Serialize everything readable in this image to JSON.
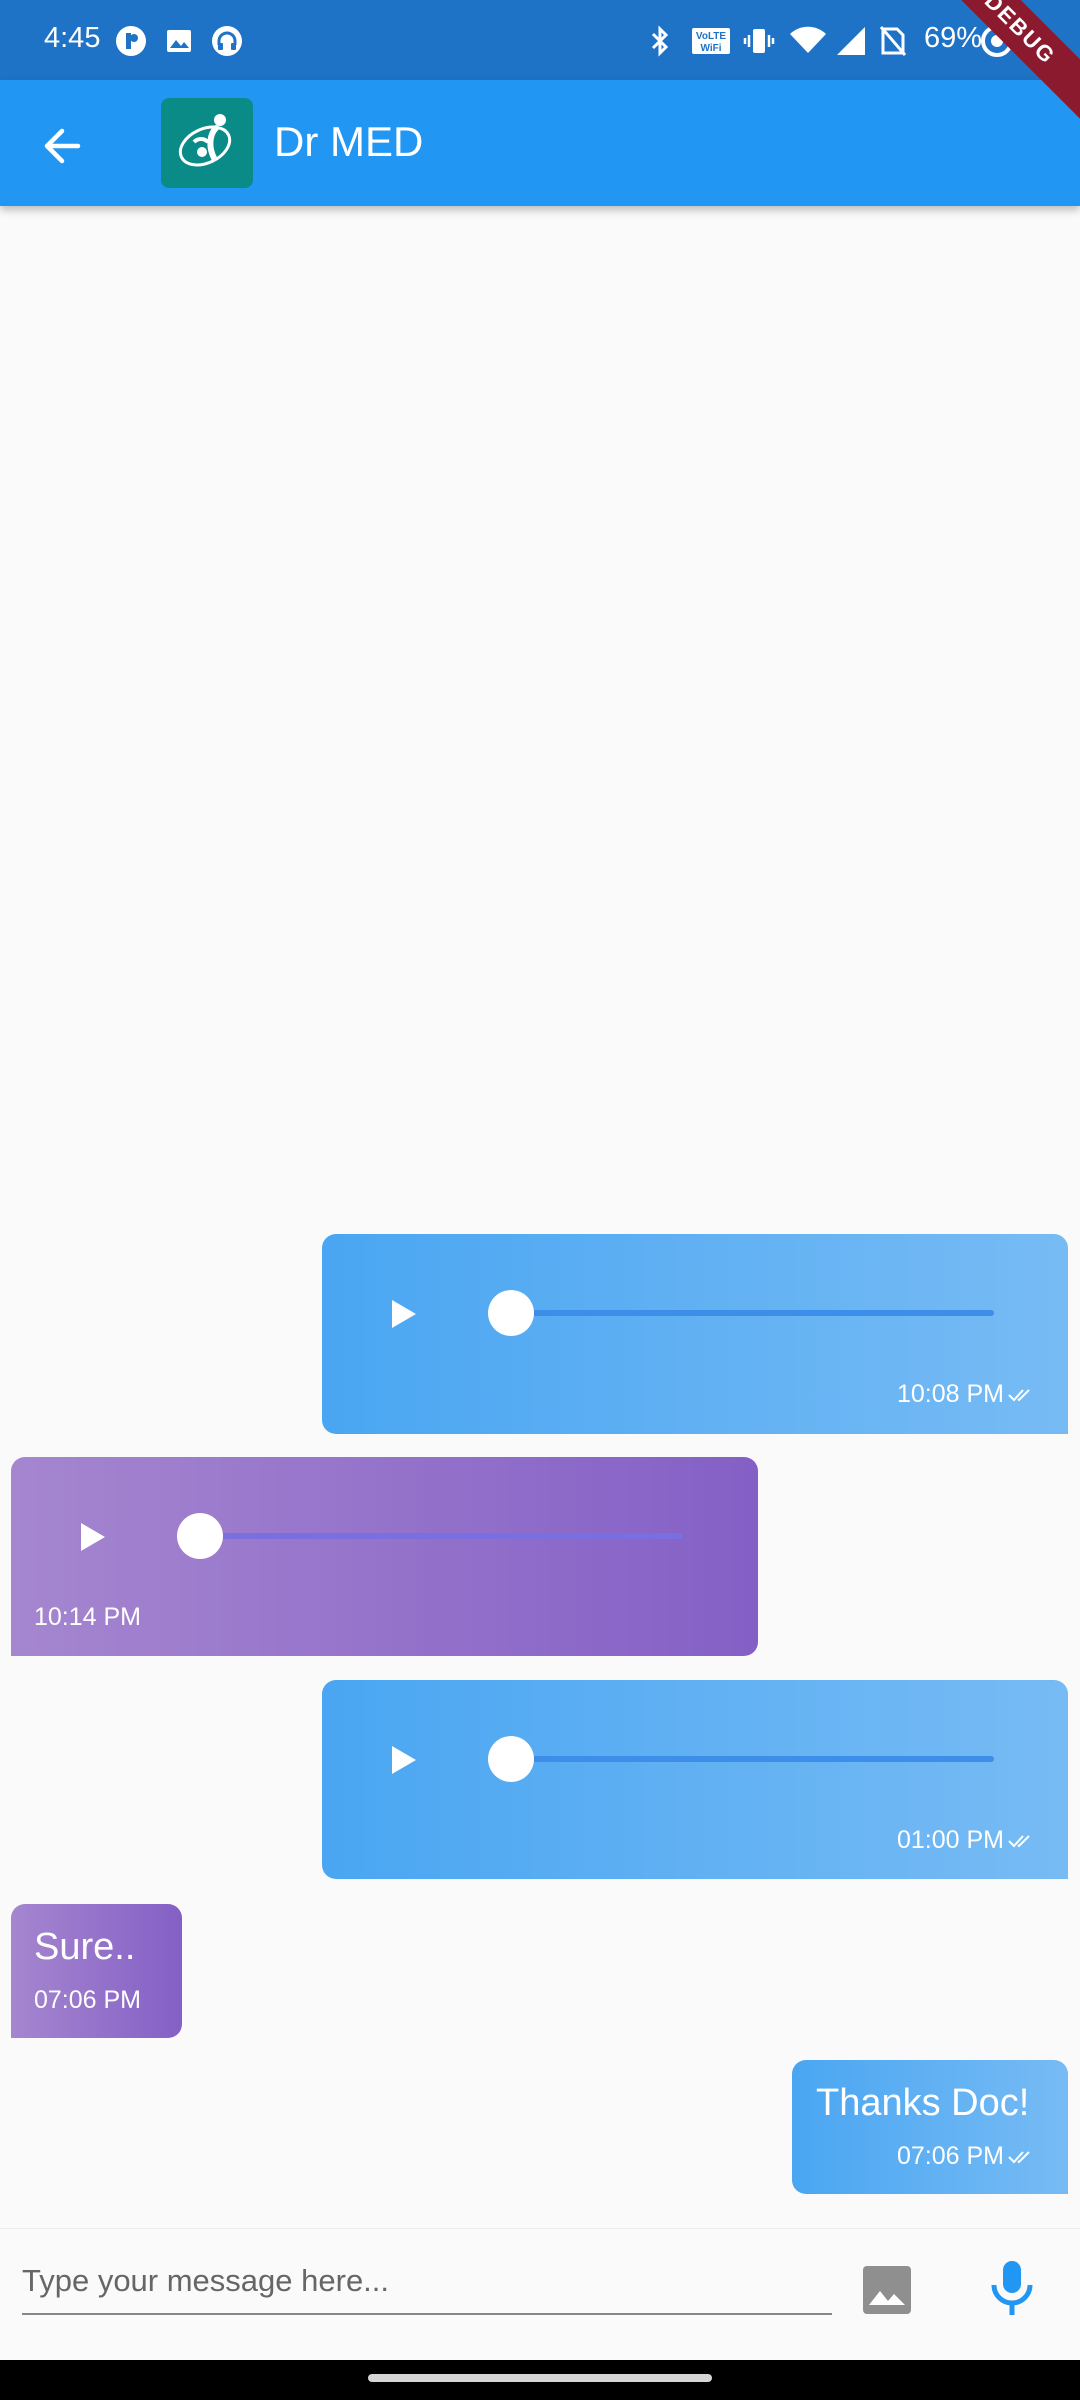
{
  "status_bar": {
    "time": "4:45",
    "battery_percent": "69%",
    "icons": [
      "app-notification-icon",
      "gallery-icon",
      "headset-icon",
      "bluetooth-icon",
      "vowifi-icon",
      "vibrate-icon",
      "wifi-icon",
      "signal-icon",
      "no-sim-icon",
      "battery-icon"
    ]
  },
  "debug_banner": "DEBUG",
  "app_bar": {
    "title": "Dr MED",
    "accent": "#2196f3"
  },
  "messages": [
    {
      "type": "audio",
      "direction": "sent",
      "time": "10:08 PM",
      "read": true,
      "progress": 0
    },
    {
      "type": "audio",
      "direction": "received",
      "time": "10:14 PM",
      "progress": 0
    },
    {
      "type": "audio",
      "direction": "sent",
      "time": "01:00 PM",
      "read": true,
      "progress": 0
    },
    {
      "type": "text",
      "direction": "received",
      "text": "Sure..",
      "time": "07:06 PM"
    },
    {
      "type": "text",
      "direction": "sent",
      "text": "Thanks Doc!",
      "time": "07:06 PM",
      "read": true
    }
  ],
  "composer": {
    "placeholder": "Type your message here...",
    "value": ""
  }
}
